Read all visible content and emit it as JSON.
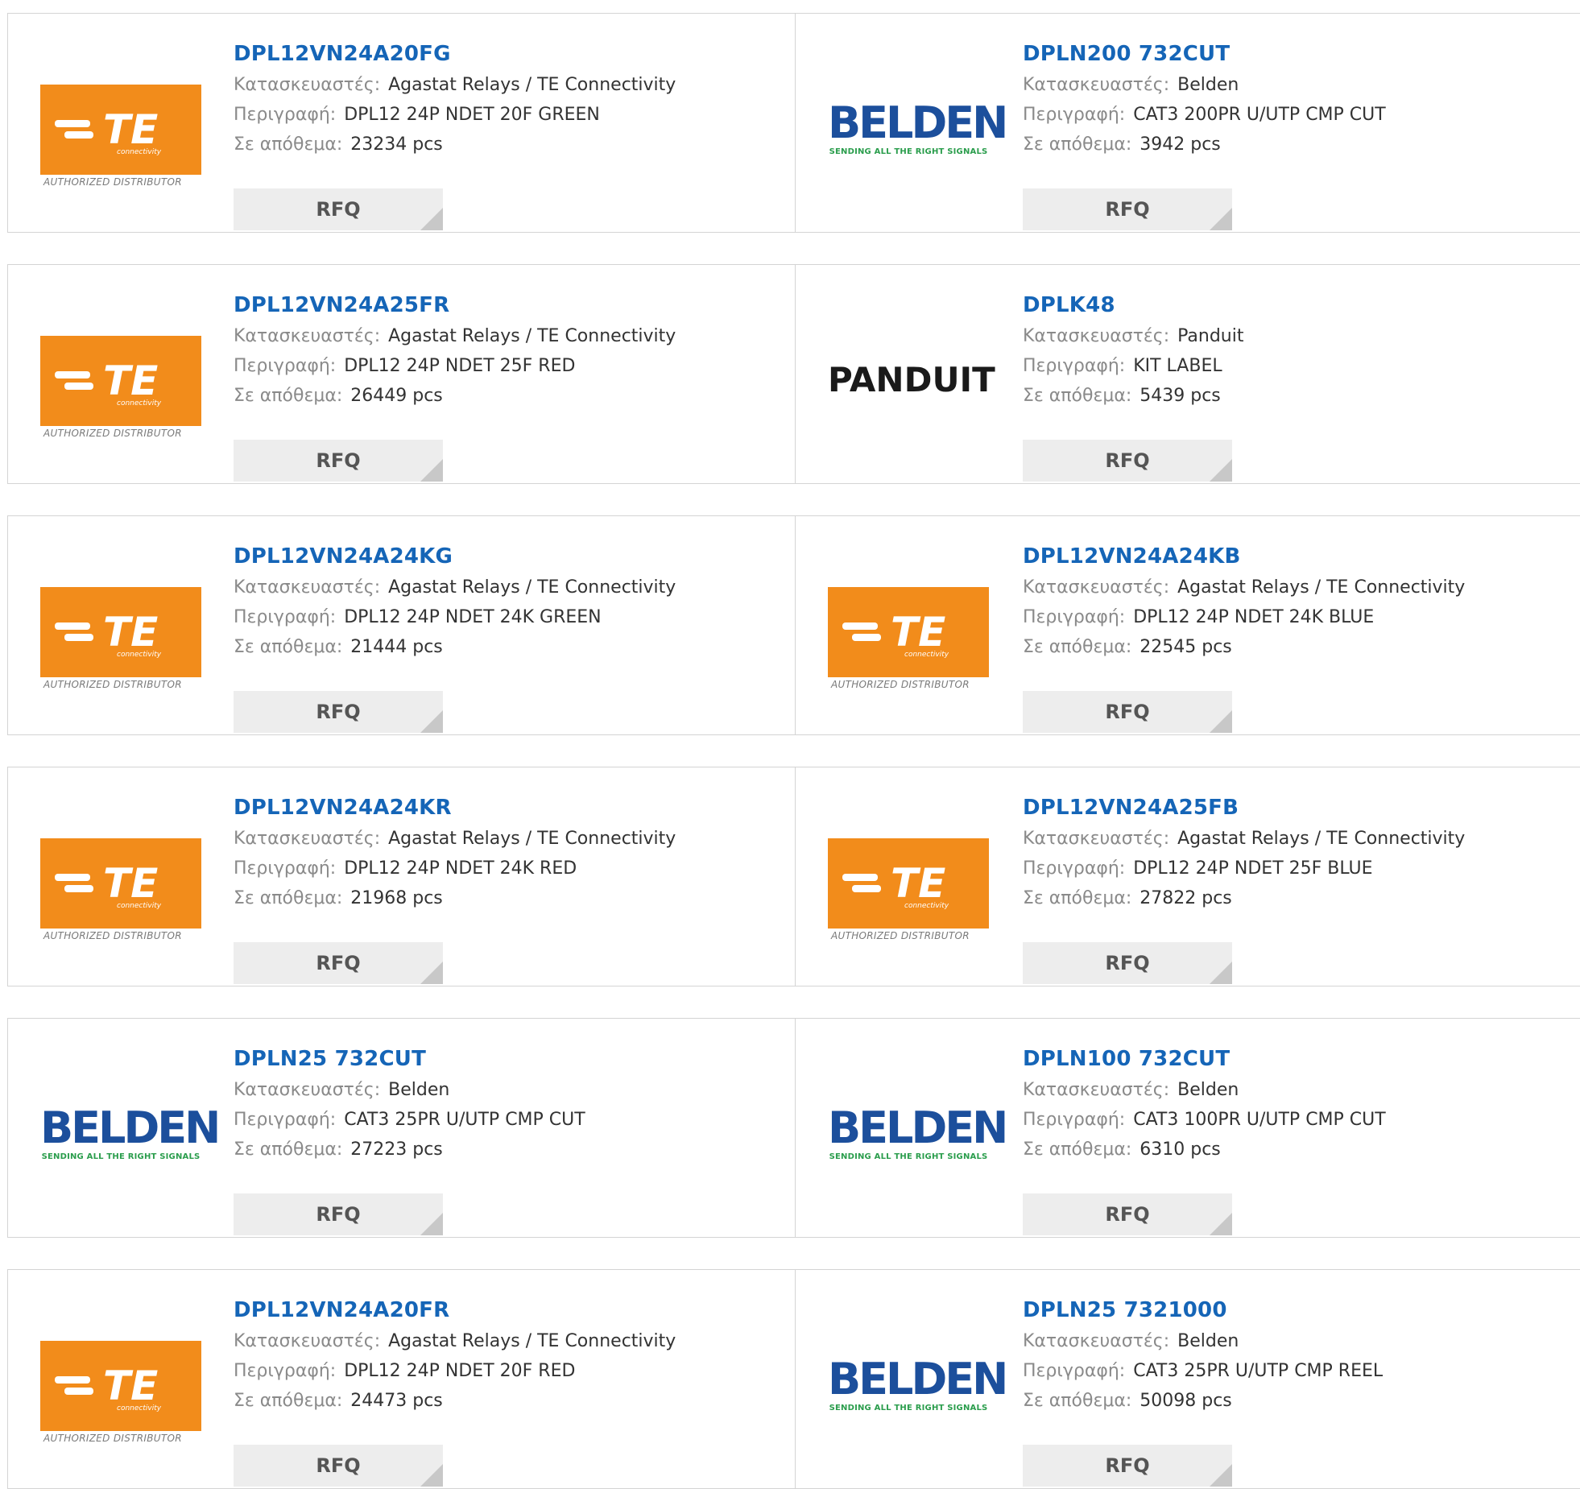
{
  "labels": {
    "manufacturer": "Κατασκευαστές:",
    "description": "Περιγραφή:",
    "stock": "Σε απόθεμα:",
    "rfq": "RFQ"
  },
  "logos": {
    "te": {
      "icon": "te-connectivity-logo",
      "text": "TE",
      "sub": "connectivity",
      "caption": "AUTHORIZED DISTRIBUTOR",
      "color": "#f28c1b"
    },
    "belden": {
      "icon": "belden-logo",
      "text": "BELDEN",
      "caption": "SENDING ALL THE RIGHT SIGNALS",
      "color": "#1c4f9c"
    },
    "panduit": {
      "icon": "panduit-logo",
      "text": "PANDUIT",
      "color": "#1a1a1a"
    }
  },
  "colors": {
    "part_link": "#1565b7",
    "label": "#8a8a8a",
    "value": "#333333",
    "rfq_bg": "#ededed"
  },
  "products": [
    {
      "part": "DPL12VN24A20FG",
      "logo": "te",
      "manufacturer": "Agastat Relays / TE Connectivity",
      "description": "DPL12 24P NDET 20F GREEN",
      "stock": "23234 pcs"
    },
    {
      "part": "DPLN200 732CUT",
      "logo": "belden",
      "manufacturer": "Belden",
      "description": "CAT3 200PR U/UTP CMP CUT",
      "stock": "3942 pcs"
    },
    {
      "part": "DPL12VN24A25FR",
      "logo": "te",
      "manufacturer": "Agastat Relays / TE Connectivity",
      "description": "DPL12 24P NDET 25F RED",
      "stock": "26449 pcs"
    },
    {
      "part": "DPLK48",
      "logo": "panduit",
      "manufacturer": "Panduit",
      "description": "KIT LABEL",
      "stock": "5439 pcs"
    },
    {
      "part": "DPL12VN24A24KG",
      "logo": "te",
      "manufacturer": "Agastat Relays / TE Connectivity",
      "description": "DPL12 24P NDET 24K GREEN",
      "stock": "21444 pcs"
    },
    {
      "part": "DPL12VN24A24KB",
      "logo": "te",
      "manufacturer": "Agastat Relays / TE Connectivity",
      "description": "DPL12 24P NDET 24K BLUE",
      "stock": "22545 pcs"
    },
    {
      "part": "DPL12VN24A24KR",
      "logo": "te",
      "manufacturer": "Agastat Relays / TE Connectivity",
      "description": "DPL12 24P NDET 24K RED",
      "stock": "21968 pcs"
    },
    {
      "part": "DPL12VN24A25FB",
      "logo": "te",
      "manufacturer": "Agastat Relays / TE Connectivity",
      "description": "DPL12 24P NDET 25F BLUE",
      "stock": "27822 pcs"
    },
    {
      "part": "DPLN25 732CUT",
      "logo": "belden",
      "manufacturer": "Belden",
      "description": "CAT3 25PR U/UTP CMP CUT",
      "stock": "27223 pcs"
    },
    {
      "part": "DPLN100 732CUT",
      "logo": "belden",
      "manufacturer": "Belden",
      "description": "CAT3 100PR U/UTP CMP CUT",
      "stock": "6310 pcs"
    },
    {
      "part": "DPL12VN24A20FR",
      "logo": "te",
      "manufacturer": "Agastat Relays / TE Connectivity",
      "description": "DPL12 24P NDET 20F RED",
      "stock": "24473 pcs"
    },
    {
      "part": "DPLN25 7321000",
      "logo": "belden",
      "manufacturer": "Belden",
      "description": "CAT3 25PR U/UTP CMP REEL",
      "stock": "50098 pcs"
    }
  ]
}
